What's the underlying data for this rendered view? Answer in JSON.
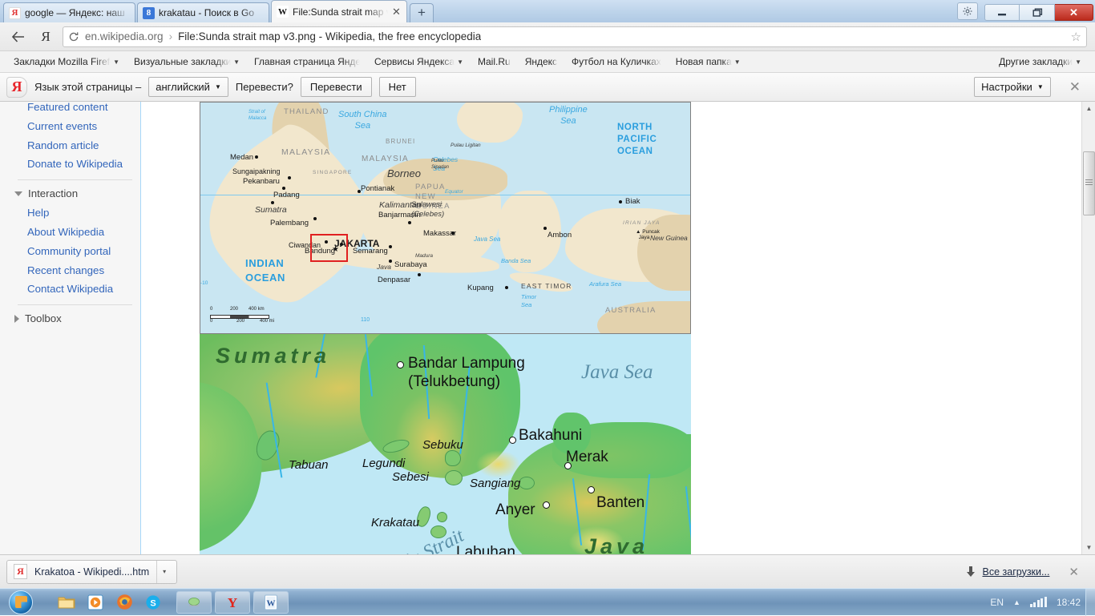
{
  "browser": {
    "tabs": [
      {
        "label": "google — Яндекс: наш",
        "favicon": "yandex-icon",
        "active": false
      },
      {
        "label": "krakatau - Поиск в Go",
        "favicon": "google-icon",
        "active": false
      },
      {
        "label": "File:Sunda strait map v",
        "favicon": "wikipedia-icon",
        "active": true
      }
    ],
    "new_tab_label": "+",
    "window_controls": {
      "minimize": "—",
      "maximize": "❐",
      "close": "✕"
    },
    "settings_icon": "gear-icon",
    "nav": {
      "back_icon": "back-arrow-icon",
      "yandex_icon": "yandex-logo-icon",
      "reload_icon": "reload-icon",
      "url_host": "en.wikipedia.org",
      "url_separator": "›",
      "url_title": "File:Sunda strait map v3.png - Wikipedia, the free encyclopedia",
      "bookmark_star_icon": "star-icon"
    },
    "bookmarks": [
      {
        "label": "Закладки Mozilla Firefox",
        "caret": true
      },
      {
        "label": "Визуальные закладки",
        "caret": true
      },
      {
        "label": "Главная страница Яндекса",
        "caret": false
      },
      {
        "label": "Сервисы Яндекса",
        "caret": true
      },
      {
        "label": "Mail.Ru",
        "caret": false
      },
      {
        "label": "Яндекс",
        "caret": false
      },
      {
        "label": "Футбол на Куличках",
        "caret": false
      },
      {
        "label": "Новая папка",
        "caret": true
      }
    ],
    "bookmarks_other": {
      "label": "Другие закладки",
      "caret": true
    }
  },
  "translate_bar": {
    "brand": "Я",
    "prompt": "Язык этой страницы –",
    "language": "английский",
    "question": "Перевести?",
    "translate_button": "Перевести",
    "no_button": "Нет",
    "settings_button": "Настройки",
    "close_icon": "close-icon"
  },
  "sidebar": {
    "links_top": [
      {
        "label": "Featured content"
      },
      {
        "label": "Current events"
      },
      {
        "label": "Random article"
      },
      {
        "label": "Donate to Wikipedia"
      }
    ],
    "section_interaction": {
      "label": "Interaction",
      "expanded": true
    },
    "links_interaction": [
      {
        "label": "Help"
      },
      {
        "label": "About Wikipedia"
      },
      {
        "label": "Community portal"
      },
      {
        "label": "Recent changes"
      },
      {
        "label": "Contact Wikipedia"
      }
    ],
    "section_toolbox": {
      "label": "Toolbox",
      "expanded": false
    }
  },
  "map_inset": {
    "oceans": [
      {
        "label": "South China\nSea",
        "type": "sea"
      },
      {
        "label": "Philippine\nSea",
        "type": "sea"
      },
      {
        "label": "NORTH\nPACIFIC\nOCEAN",
        "type": "ocean"
      },
      {
        "label": "INDIAN\nOCEAN",
        "type": "ocean"
      },
      {
        "label": "Celebes\nSea",
        "type": "sea"
      },
      {
        "label": "Java Sea",
        "type": "sea"
      },
      {
        "label": "Banda Sea",
        "type": "sea"
      },
      {
        "label": "Arafura Sea",
        "type": "sea"
      },
      {
        "label": "Timor\nSea",
        "type": "sea"
      },
      {
        "label": "Strait of\nMalacca",
        "type": "sea"
      }
    ],
    "countries": [
      "THAILAND",
      "MALAYSIA",
      "BRUNEI",
      "MALAYSIA",
      "SINGAPORE",
      "PAPUA NEW GUINEA",
      "AUSTRALIA",
      "EAST TIMOR",
      "IRIAN JAYA"
    ],
    "islands": [
      "Sumatra",
      "Borneo",
      "Kalimantan",
      "Sulawesi (Celebes)",
      "Java",
      "Madura",
      "New Guinea",
      "Pulau Ligitan",
      "Pulau Sipadan"
    ],
    "cities": [
      "Medan",
      "Sungaipakning",
      "Pekanbaru",
      "Padang",
      "Palembang",
      "Pontianak",
      "Banjarmasin",
      "Ciwandan",
      "JAKARTA",
      "Bandung",
      "Semarang",
      "Surabaya",
      "Denpasar",
      "Makassar",
      "Ambon",
      "Kupang",
      "Biak",
      "Puncak Jaya"
    ],
    "equator_label": "Equator",
    "scale": {
      "km_ticks": [
        "0",
        "200",
        "400 km"
      ],
      "mi_ticks": [
        "0",
        "200",
        "400 mi"
      ]
    },
    "grid_labels": [
      "10",
      "110"
    ],
    "highlight_box": "red-rectangle-sunda-strait"
  },
  "map_main": {
    "region_labels": [
      {
        "name": "Sumatra",
        "type": "island"
      },
      {
        "name": "Java",
        "type": "island"
      }
    ],
    "sea_labels": [
      {
        "name": "Java Sea"
      },
      {
        "name": "Sunda Strait"
      }
    ],
    "cities": [
      {
        "name": "Bandar Lampung"
      },
      {
        "name": "(Telukbetung)"
      },
      {
        "name": "Bakahuni"
      },
      {
        "name": "Merak"
      },
      {
        "name": "Banten"
      },
      {
        "name": "Anyer"
      },
      {
        "name": "Labuhan"
      }
    ],
    "islands": [
      {
        "name": "Tabuan"
      },
      {
        "name": "Legundi"
      },
      {
        "name": "Sebuku"
      },
      {
        "name": "Sebesi"
      },
      {
        "name": "Sangiang"
      },
      {
        "name": "Krakatau"
      }
    ]
  },
  "downloads_bar": {
    "item": {
      "label": "Krakatoa - Wikipedi....htm",
      "icon": "html-file-icon",
      "caret": "▾"
    },
    "all_downloads": {
      "label": "Все загрузки...",
      "icon": "download-arrow-icon"
    },
    "close_icon": "close-icon"
  },
  "taskbar": {
    "start_icon": "windows-start-orb",
    "pinned": [
      {
        "name": "explorer-icon"
      },
      {
        "name": "media-player-icon"
      },
      {
        "name": "firefox-icon"
      },
      {
        "name": "skype-icon"
      }
    ],
    "windows": [
      {
        "name": "paint-window-icon"
      },
      {
        "name": "yandex-browser-window-icon"
      },
      {
        "name": "word-window-icon"
      }
    ],
    "tray": {
      "language": "EN",
      "show_hidden_icon": "chevron-up-icon",
      "network_icon": "signal-bars-icon",
      "clock": "18:42"
    }
  }
}
